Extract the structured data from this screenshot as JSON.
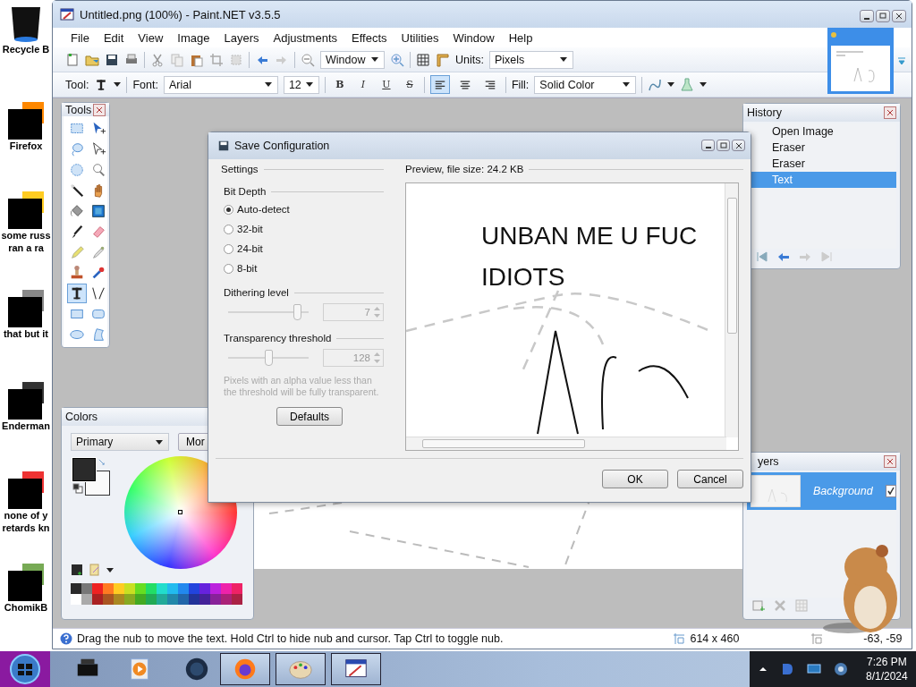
{
  "desktop_icons": [
    {
      "lines": [
        "Recycle B"
      ]
    },
    {
      "lines": [
        "Firefox"
      ]
    },
    {
      "lines": [
        "some russ",
        "ran a ra"
      ]
    },
    {
      "lines": [
        "that but it"
      ]
    },
    {
      "lines": [
        "Enderman"
      ]
    },
    {
      "lines": [
        "none of y",
        "retards kn"
      ]
    },
    {
      "lines": [
        "ChomikB"
      ]
    }
  ],
  "window": {
    "title": "Untitled.png (100%) - Paint.NET v3.5.5"
  },
  "menu": [
    "File",
    "Edit",
    "View",
    "Image",
    "Layers",
    "Adjustments",
    "Effects",
    "Utilities",
    "Window",
    "Help"
  ],
  "toolbar": {
    "zoom": "Window",
    "units_label": "Units:",
    "units": "Pixels"
  },
  "text_toolbar": {
    "tool_label": "Tool:",
    "font_label": "Font:",
    "font": "Arial",
    "size": "12",
    "styles": [
      "B",
      "I",
      "U",
      "S"
    ],
    "alignments": [
      {
        "selected": true
      },
      {
        "selected": false
      },
      {
        "selected": false
      }
    ],
    "fill_label": "Fill:",
    "fill": "Solid Color"
  },
  "tools_panel": {
    "title": "Tools",
    "tools": [
      {
        "selected": false
      },
      {
        "selected": false
      },
      {
        "selected": false
      },
      {
        "selected": false
      },
      {
        "selected": false
      },
      {
        "selected": false
      },
      {
        "selected": false
      },
      {
        "selected": false
      },
      {
        "selected": false
      },
      {
        "selected": false
      },
      {
        "selected": false
      },
      {
        "selected": false
      },
      {
        "selected": false
      },
      {
        "selected": false
      },
      {
        "selected": false
      },
      {
        "selected": false
      },
      {
        "selected": true
      },
      {
        "selected": false
      },
      {
        "selected": false
      },
      {
        "selected": false
      },
      {
        "selected": false
      },
      {
        "selected": false
      }
    ]
  },
  "colors_panel": {
    "title": "Colors",
    "mode": "Primary",
    "more_button": "Mor"
  },
  "history_panel": {
    "title": "History",
    "items": [
      {
        "label": "Open Image",
        "selected": false
      },
      {
        "label": "Eraser",
        "selected": false
      },
      {
        "label": "Eraser",
        "selected": false
      },
      {
        "label": "Text",
        "selected": true
      }
    ]
  },
  "layers_panel": {
    "title": "yers",
    "layers": [
      {
        "name": "Background",
        "visible": true,
        "selected": true
      }
    ]
  },
  "status_bar": {
    "hint": "Drag the nub to move the text. Hold Ctrl to hide nub and cursor. Tap Ctrl to toggle nub.",
    "image_size": "614 x 460",
    "cursor_position": "-63, -59"
  },
  "dialog": {
    "title": "Save Configuration",
    "settings_heading": "Settings",
    "preview_heading": "Preview, file size: 24.2 KB",
    "bit_depth_heading": "Bit Depth",
    "bit_depths": [
      {
        "label": "Auto-detect",
        "selected": true
      },
      {
        "label": "32-bit",
        "selected": false
      },
      {
        "label": "24-bit",
        "selected": false
      },
      {
        "label": "8-bit",
        "selected": false
      }
    ],
    "sliders": [
      {
        "label": "Dithering level",
        "value": "7",
        "level": 0.85,
        "disabled": true
      },
      {
        "label": "Transparency threshold",
        "value": "128",
        "level": 0.5,
        "disabled": true
      }
    ],
    "note": "Pixels with an alpha value less than the threshold will be fully transparent.",
    "defaults_button": "Defaults",
    "ok_button": "OK",
    "cancel_button": "Cancel",
    "preview_lines": [
      "UNBAN ME U FUC",
      "IDIOTS"
    ]
  },
  "taskbar": {
    "apps": [
      {
        "open": false
      },
      {
        "open": false
      },
      {
        "open": false
      },
      {
        "open": true
      },
      {
        "open": true
      },
      {
        "open": true
      }
    ],
    "time": "7:26 PM",
    "date": "8/1/2024"
  }
}
